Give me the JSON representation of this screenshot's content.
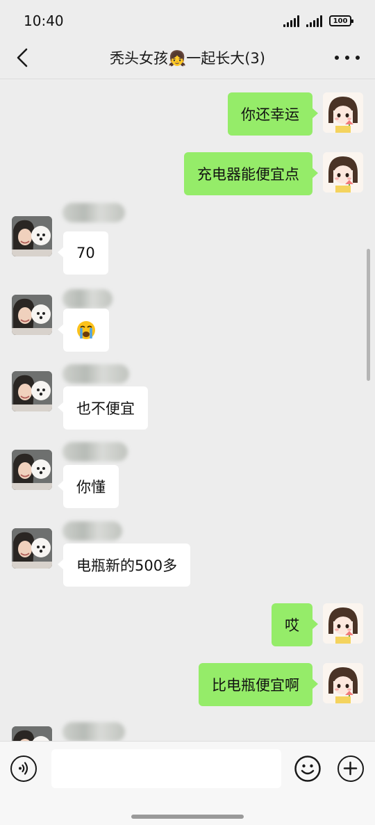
{
  "status_bar": {
    "time": "10:40",
    "battery": "100"
  },
  "nav": {
    "title": "秃头女孩👧一起长大(3)"
  },
  "messages": [
    {
      "side": "me",
      "text": "你还幸运"
    },
    {
      "side": "me",
      "text": "充电器能便宜点"
    },
    {
      "side": "other",
      "text": "70"
    },
    {
      "side": "other",
      "emoji": "crying-face"
    },
    {
      "side": "other",
      "text": "也不便宜"
    },
    {
      "side": "other",
      "text": "你懂"
    },
    {
      "side": "other",
      "text": "电瓶新的500多"
    },
    {
      "side": "me",
      "text": "哎"
    },
    {
      "side": "me",
      "text": "比电瓶便宜啊"
    }
  ],
  "input": {
    "value": ""
  },
  "icons": {
    "back": "chevron-left-icon",
    "more": "more-horizontal-icon",
    "voice": "voice-icon",
    "emoji": "smiley-icon",
    "plus": "plus-icon"
  },
  "colors": {
    "bubble_me": "#95ec69",
    "bubble_other": "#ffffff",
    "background": "#ededed"
  }
}
